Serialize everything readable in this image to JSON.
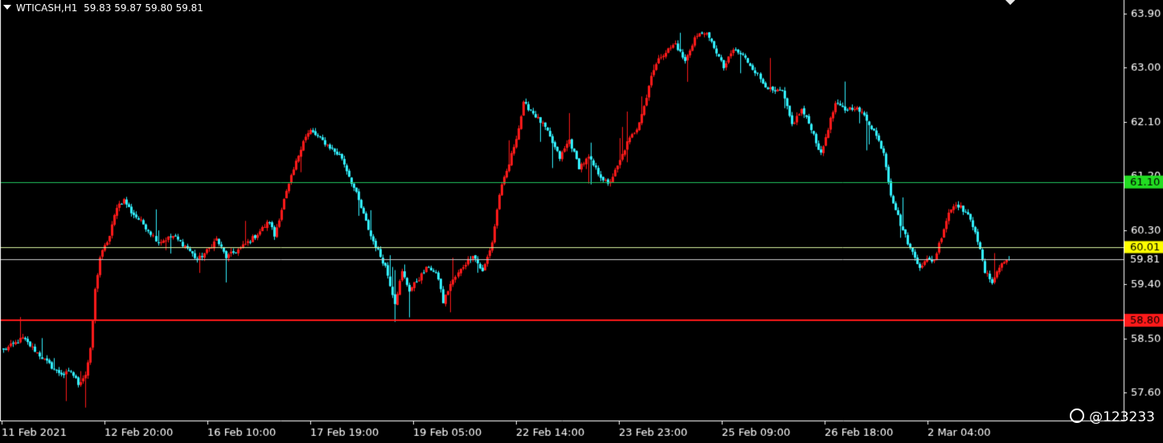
{
  "header": {
    "symbol": "WTICASH,H1",
    "ohlc": "59.83 59.87 59.80 59.81"
  },
  "watermark": "@123233",
  "chart_data": {
    "type": "candlestick",
    "symbol": "WTICASH",
    "timeframe": "H1",
    "ylim": [
      56.9,
      64.3
    ],
    "y_ticks": [
      "63.90",
      "63.00",
      "62.10",
      "61.20",
      "60.30",
      "59.40",
      "58.50",
      "57.60"
    ],
    "x_ticks": [
      "11 Feb 2021",
      "12 Feb 20:00",
      "16 Feb 10:00",
      "17 Feb 19:00",
      "19 Feb 05:00",
      "22 Feb 14:00",
      "23 Feb 23:00",
      "25 Feb 09:00",
      "26 Feb 18:00",
      "2 Mar 04:00"
    ],
    "bar_count": 250,
    "colors": {
      "background": "#000000",
      "up": "#ff1a1a",
      "down": "#33f0ff",
      "axis": "#ffffff"
    },
    "horizontal_lines": [
      {
        "price": 61.1,
        "label": "61.10",
        "color": "#22c55e",
        "label_bg": "#22dd22",
        "label_fg": "#000000",
        "width": 1
      },
      {
        "price": 60.01,
        "label": "60.01",
        "color": "#d8f5a0",
        "label_bg": "#ffff00",
        "label_fg": "#000000",
        "width": 1
      },
      {
        "price": 59.81,
        "label": "59.81",
        "color": "#cccccc",
        "label_bg": "#000000",
        "label_fg": "#ffffff",
        "width": 1
      },
      {
        "price": 58.8,
        "label": "58.80",
        "color": "#ff1a1a",
        "label_bg": "#ff1a1a",
        "label_fg": "#000000",
        "width": 2
      }
    ],
    "price_path": [
      [
        0,
        58.3
      ],
      [
        8,
        58.5
      ],
      [
        18,
        58.1
      ],
      [
        22,
        57.95
      ],
      [
        25,
        57.9
      ],
      [
        28,
        57.95
      ],
      [
        31,
        57.75
      ],
      [
        34,
        57.9
      ],
      [
        36,
        58.3
      ],
      [
        38,
        59.3
      ],
      [
        40,
        59.85
      ],
      [
        44,
        60.2
      ],
      [
        47,
        60.7
      ],
      [
        50,
        60.8
      ],
      [
        53,
        60.6
      ],
      [
        58,
        60.4
      ],
      [
        64,
        60.1
      ],
      [
        70,
        60.2
      ],
      [
        76,
        60.0
      ],
      [
        80,
        59.8
      ],
      [
        84,
        59.95
      ],
      [
        88,
        60.15
      ],
      [
        92,
        59.85
      ],
      [
        98,
        60.0
      ],
      [
        104,
        60.2
      ],
      [
        110,
        60.45
      ],
      [
        112,
        60.2
      ],
      [
        116,
        60.8
      ],
      [
        120,
        61.3
      ],
      [
        124,
        61.8
      ],
      [
        127,
        61.95
      ],
      [
        133,
        61.75
      ],
      [
        140,
        61.5
      ],
      [
        146,
        60.9
      ],
      [
        152,
        60.2
      ],
      [
        158,
        59.7
      ],
      [
        162,
        59.1
      ],
      [
        165,
        59.6
      ],
      [
        168,
        59.3
      ],
      [
        172,
        59.5
      ],
      [
        176,
        59.7
      ],
      [
        180,
        59.5
      ],
      [
        182,
        59.1
      ],
      [
        185,
        59.4
      ],
      [
        190,
        59.7
      ],
      [
        194,
        59.9
      ],
      [
        198,
        59.6
      ],
      [
        202,
        60.1
      ],
      [
        205,
        60.9
      ],
      [
        209,
        61.4
      ],
      [
        213,
        62.0
      ],
      [
        215,
        62.4
      ],
      [
        218,
        62.3
      ],
      [
        224,
        62.0
      ],
      [
        230,
        61.5
      ],
      [
        234,
        61.8
      ],
      [
        238,
        61.35
      ],
      [
        242,
        61.5
      ],
      [
        246,
        61.25
      ],
      [
        250,
        61.05
      ],
      [
        254,
        61.35
      ],
      [
        258,
        61.75
      ],
      [
        262,
        62.0
      ],
      [
        266,
        62.5
      ],
      [
        268,
        62.9
      ],
      [
        272,
        63.2
      ],
      [
        278,
        63.4
      ],
      [
        282,
        63.1
      ],
      [
        286,
        63.5
      ],
      [
        290,
        63.6
      ],
      [
        294,
        63.35
      ],
      [
        298,
        63.0
      ],
      [
        302,
        63.3
      ],
      [
        306,
        63.2
      ],
      [
        310,
        63.0
      ],
      [
        314,
        62.75
      ],
      [
        318,
        62.6
      ],
      [
        322,
        62.6
      ],
      [
        326,
        62.05
      ],
      [
        330,
        62.3
      ],
      [
        334,
        62.0
      ],
      [
        338,
        61.55
      ],
      [
        341,
        62.0
      ],
      [
        344,
        62.4
      ],
      [
        348,
        62.3
      ],
      [
        352,
        62.35
      ],
      [
        356,
        62.2
      ],
      [
        360,
        61.95
      ],
      [
        364,
        61.6
      ],
      [
        367,
        60.9
      ],
      [
        371,
        60.4
      ],
      [
        375,
        60.0
      ],
      [
        379,
        59.7
      ],
      [
        382,
        59.8
      ],
      [
        385,
        59.8
      ],
      [
        388,
        60.2
      ],
      [
        391,
        60.6
      ],
      [
        394,
        60.75
      ],
      [
        398,
        60.6
      ],
      [
        402,
        60.3
      ],
      [
        406,
        59.6
      ],
      [
        409,
        59.45
      ],
      [
        413,
        59.75
      ],
      [
        416,
        59.81
      ]
    ]
  }
}
